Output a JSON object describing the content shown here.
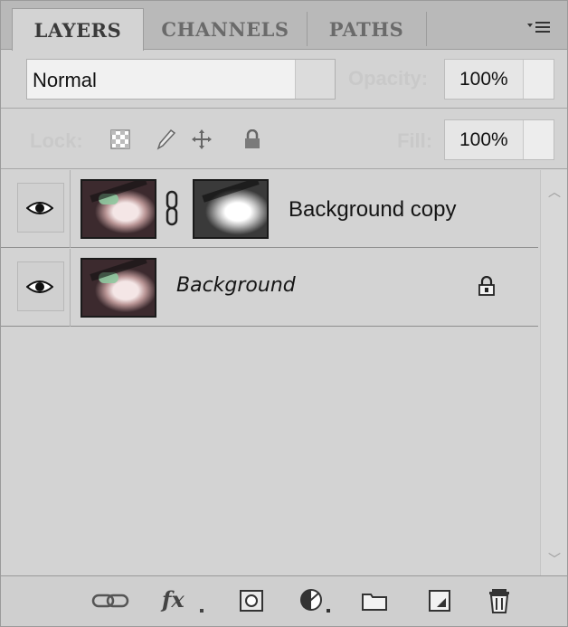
{
  "tabs": [
    {
      "label": "LAYERS",
      "active": true
    },
    {
      "label": "CHANNELS",
      "active": false
    },
    {
      "label": "PATHS",
      "active": false
    }
  ],
  "panel_menu_icon": "panel-menu-icon",
  "blend": {
    "mode": "Normal",
    "opacity_label": "Opacity:",
    "opacity_value": "100%"
  },
  "lock": {
    "label": "Lock:",
    "fill_label": "Fill:",
    "fill_value": "100%",
    "icons": [
      "lock-transparent-icon",
      "lock-image-icon",
      "lock-position-icon",
      "lock-all-icon"
    ]
  },
  "layers": [
    {
      "name": "Background copy",
      "visible": true,
      "has_mask": true,
      "locked": false,
      "italic": false
    },
    {
      "name": "Background",
      "visible": true,
      "has_mask": false,
      "locked": true,
      "italic": true
    }
  ],
  "toolbar": [
    "link-layers-icon",
    "fx-icon",
    "add-mask-icon",
    "adjustment-layer-icon",
    "new-group-icon",
    "new-layer-icon",
    "delete-icon"
  ],
  "colors": {
    "panel": "#d3d3d3",
    "tabbar": "#b9b9b9",
    "field": "#f1f1f1"
  }
}
